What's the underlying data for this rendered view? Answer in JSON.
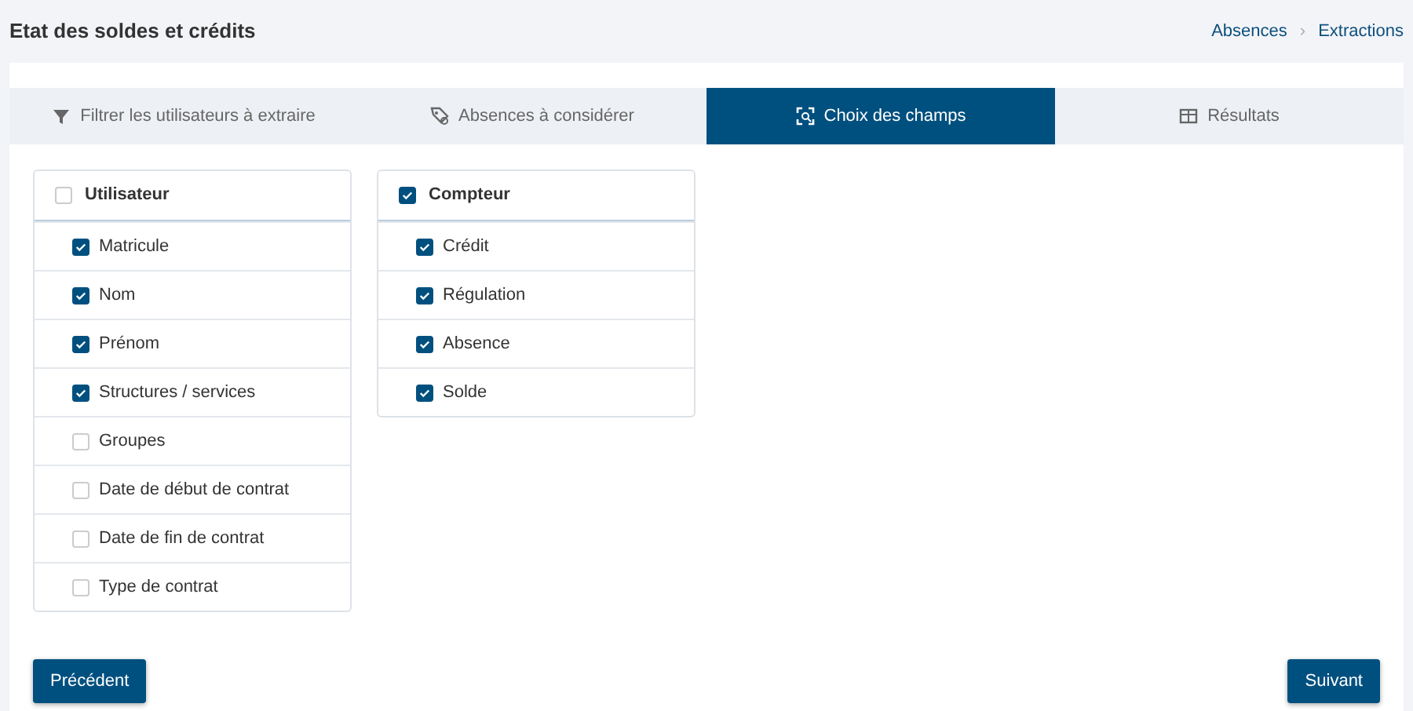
{
  "page_title": "Etat des soldes et crédits",
  "breadcrumb": [
    {
      "label": "Absences"
    },
    {
      "label": "›"
    },
    {
      "label": "Extractions"
    }
  ],
  "tabs": [
    {
      "label": "Filtrer les utilisateurs à extraire",
      "selected": false
    },
    {
      "label": "Absences à considérer",
      "selected": false
    },
    {
      "label": "Choix des champs",
      "selected": true
    },
    {
      "label": "Résultats",
      "selected": false
    }
  ],
  "groups": [
    {
      "label": "Utilisateur",
      "checked": false,
      "fields": [
        {
          "label": "Matricule",
          "checked": true
        },
        {
          "label": "Nom",
          "checked": true
        },
        {
          "label": "Prénom",
          "checked": true
        },
        {
          "label": "Structures / services",
          "checked": true
        },
        {
          "label": "Groupes",
          "checked": false
        },
        {
          "label": "Date de début de contrat",
          "checked": false
        },
        {
          "label": "Date de fin de contrat",
          "checked": false
        },
        {
          "label": "Type de contrat",
          "checked": false
        }
      ]
    },
    {
      "label": "Compteur",
      "checked": true,
      "fields": [
        {
          "label": "Crédit",
          "checked": true
        },
        {
          "label": "Régulation",
          "checked": true
        },
        {
          "label": "Absence",
          "checked": true
        },
        {
          "label": "Solde",
          "checked": true
        }
      ]
    }
  ],
  "buttons": [
    {
      "label": "Précédent"
    },
    {
      "label": "Suivant"
    }
  ]
}
